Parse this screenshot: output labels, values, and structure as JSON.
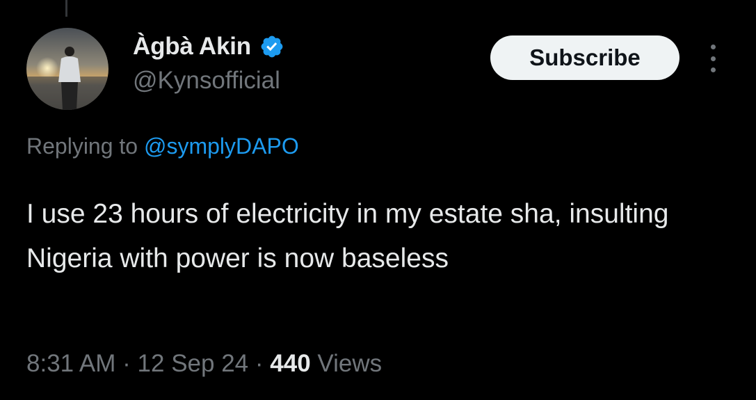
{
  "author": {
    "display_name": "Àgbà Akin",
    "handle": "@Kynsofficial",
    "verified": true,
    "verified_color": "#1d9bf0"
  },
  "actions": {
    "subscribe_label": "Subscribe",
    "more_icon": "more-vertical-icon"
  },
  "reply": {
    "prefix": "Replying to",
    "mention": "@symplyDAPO"
  },
  "tweet": {
    "text": "I use 23 hours of electricity in my estate sha, insulting Nigeria with power is now baseless"
  },
  "meta": {
    "time": "8:31 AM",
    "separator": "·",
    "date": "12 Sep 24",
    "views_count": "440",
    "views_label": "Views"
  },
  "colors": {
    "background": "#000000",
    "text_primary": "#e7e9ea",
    "text_secondary": "#71767b",
    "accent": "#1d9bf0",
    "button_bg": "#eff3f4"
  }
}
